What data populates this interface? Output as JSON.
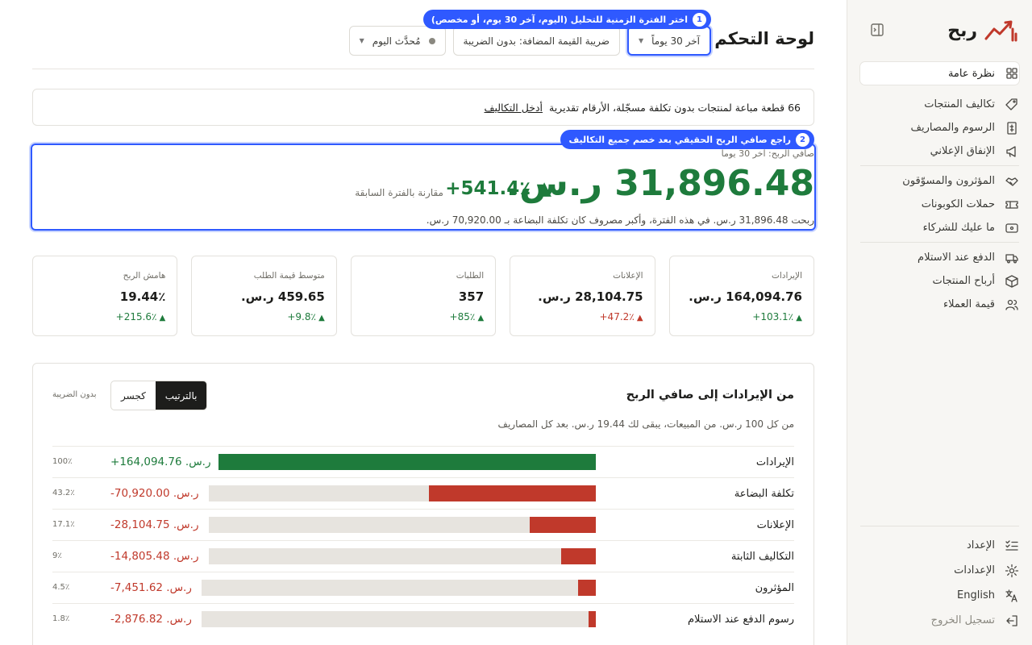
{
  "brand": {
    "name": "ربح"
  },
  "sidebar": {
    "groups": [
      [
        {
          "label": "نظرة عامة",
          "icon": "grid-icon",
          "active": true
        }
      ],
      [
        {
          "label": "تكاليف المنتجات",
          "icon": "tag-icon"
        },
        {
          "label": "الرسوم والمصاريف",
          "icon": "receipt-icon"
        },
        {
          "label": "الإنفاق الإعلاني",
          "icon": "megaphone-icon"
        }
      ],
      [
        {
          "label": "المؤثرون والمسوّقون",
          "icon": "handshake-icon"
        },
        {
          "label": "حملات الكوبونات",
          "icon": "ticket-icon"
        },
        {
          "label": "ما عليك للشركاء",
          "icon": "wallet-icon"
        }
      ],
      [
        {
          "label": "الدفع عند الاستلام",
          "icon": "truck-icon"
        },
        {
          "label": "أرباح المنتجات",
          "icon": "box-icon"
        },
        {
          "label": "قيمة العملاء",
          "icon": "users-icon"
        }
      ]
    ],
    "bottom": [
      {
        "label": "الإعداد",
        "icon": "checklist-icon"
      },
      {
        "label": "الإعدادات",
        "icon": "gear-icon"
      },
      {
        "label": "English",
        "icon": "language-icon"
      },
      {
        "label": "تسجيل الخروج",
        "icon": "logout-icon",
        "muted": true
      }
    ]
  },
  "header": {
    "title": "لوحة التحكم",
    "period": "آخر 30 يوماً",
    "vat": "ضريبة القيمة المضافة: بدون الضريبة",
    "updated": "مُحدَّث اليوم"
  },
  "tips": {
    "one": {
      "num": "1",
      "text": "اختر الفترة الزمنية للتحليل (اليوم، آخر 30 يوم، أو مخصص)"
    },
    "two": {
      "num": "2",
      "text": "راجع صافي الربح الحقيقي بعد خصم جميع التكاليف"
    }
  },
  "notice": {
    "text": "66 قطعة مباعة لمنتجات بدون تكلفة مسجّلة، الأرقام تقديرية",
    "link": "أدخل التكاليف"
  },
  "profit": {
    "label": "صافي الربح: آخر 30 يوماً",
    "value": "31,896.48 ر.س.",
    "change": "▲ 541.4٪+",
    "compare": "مقارنة بالفترة السابقة",
    "note": "ربحت 31,896.48 ر.س. في هذه الفترة، وأكبر مصروف كان تكلفة البضاعة بـ 70,920.00 ر.س."
  },
  "kpis": [
    {
      "label": "الإيرادات",
      "value": "164,094.76 ر.س.",
      "change": "+103.1٪",
      "dir": "up"
    },
    {
      "label": "الإعلانات",
      "value": "28,104.75 ر.س.",
      "change": "+47.2٪",
      "dir": "down"
    },
    {
      "label": "الطلبات",
      "value": "357",
      "change": "+85٪",
      "dir": "up"
    },
    {
      "label": "متوسط قيمة الطلب",
      "value": "459.65 ر.س.",
      "change": "+9.8٪",
      "dir": "up"
    },
    {
      "label": "هامش الربح",
      "value": "19.44٪",
      "change": "+215.6٪",
      "dir": "up"
    }
  ],
  "flow": {
    "title": "من الإيرادات إلى صافي الربح",
    "subtitle": "من كل 100 ر.س. من المبيعات، يبقى لك 19.44 ر.س. بعد كل المصاريف",
    "toggle_on": "بالترتيب",
    "toggle_off": "كجسر",
    "tax": "بدون الضريبة",
    "colors": {
      "positive": "#1e7b3c",
      "negative": "#c0392b",
      "track": "#e7e4df"
    },
    "rows": [
      {
        "label": "الإيرادات",
        "amount": "ر.س. 164,094.76+",
        "pct": "100٪",
        "fraction": 1.0,
        "positive": true
      },
      {
        "label": "تكلفة البضاعة",
        "amount": "ر.س. 70,920.00-",
        "pct": "43.2٪",
        "fraction": 0.432,
        "positive": false
      },
      {
        "label": "الإعلانات",
        "amount": "ر.س. 28,104.75-",
        "pct": "17.1٪",
        "fraction": 0.171,
        "positive": false
      },
      {
        "label": "التكاليف الثابتة",
        "amount": "ر.س. 14,805.48-",
        "pct": "9٪",
        "fraction": 0.09,
        "positive": false
      },
      {
        "label": "المؤثرون",
        "amount": "ر.س. 7,451.62-",
        "pct": "4.5٪",
        "fraction": 0.045,
        "positive": false
      },
      {
        "label": "رسوم الدفع عند الاستلام",
        "amount": "ر.س. 2,876.82-",
        "pct": "1.8٪",
        "fraction": 0.018,
        "positive": false
      }
    ]
  }
}
